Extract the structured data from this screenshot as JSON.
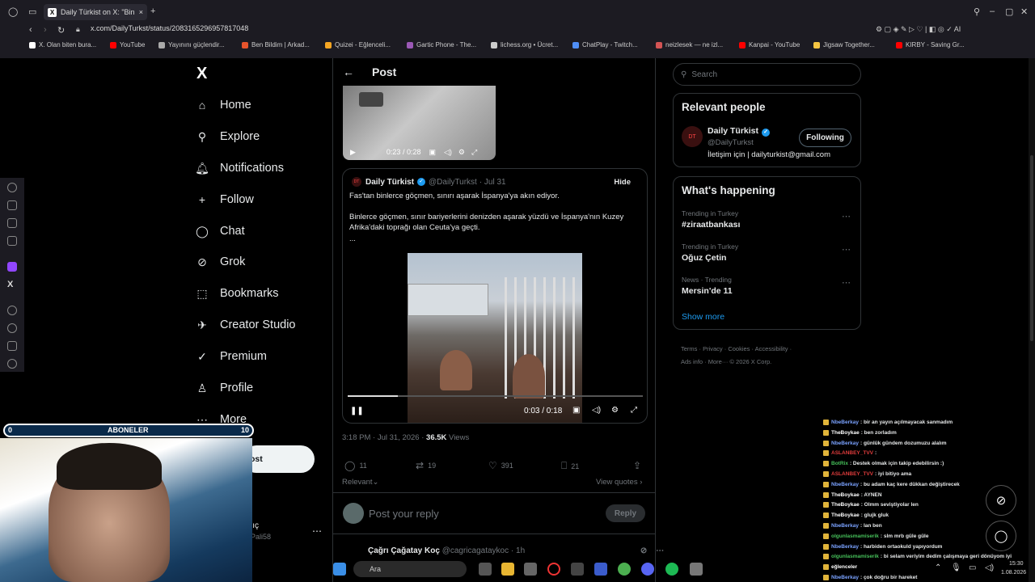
{
  "browser": {
    "tab_title": "Daily Türkist on X: \"Bin",
    "tab_icon": "X",
    "url": "x.com/DailyTurkst/status/2083165296957817048",
    "bookmarks": [
      {
        "label": "X. Olan biten bura...",
        "color": "#ffffff"
      },
      {
        "label": "YouTube",
        "color": "#ff0000"
      },
      {
        "label": "Yayınını güçlendir...",
        "color": "#aaaaaa"
      },
      {
        "label": "Ben Bildim | Arkad...",
        "color": "#e6542c"
      },
      {
        "label": "Quizei - Eğlenceli...",
        "color": "#f5a623"
      },
      {
        "label": "Gartic Phone - The...",
        "color": "#9b59b6"
      },
      {
        "label": "lichess.org • Ücret...",
        "color": "#cccccc"
      },
      {
        "label": "ChatPlay - Twitch...",
        "color": "#4f8ef7"
      },
      {
        "label": "neizlesek — ne izl...",
        "color": "#d35454"
      },
      {
        "label": "Kanpai - YouTube",
        "color": "#ff0000"
      },
      {
        "label": "Jigsaw Together...",
        "color": "#f5c542"
      },
      {
        "label": "KIRBY - Saving Gr...",
        "color": "#ff0000"
      }
    ]
  },
  "sidebar": {
    "logo": "X",
    "items": [
      {
        "label": "Home",
        "icon": "⌂"
      },
      {
        "label": "Explore",
        "icon": "⚲"
      },
      {
        "label": "Notifications",
        "icon": "🔔︎"
      },
      {
        "label": "Follow",
        "icon": "+"
      },
      {
        "label": "Chat",
        "icon": "◯"
      },
      {
        "label": "Grok",
        "icon": "⊘"
      },
      {
        "label": "Bookmarks",
        "icon": "⬚"
      },
      {
        "label": "Creator Studio",
        "icon": "✈"
      },
      {
        "label": "Premium",
        "icon": "✓"
      },
      {
        "label": "Profile",
        "icon": "♙"
      },
      {
        "label": "More",
        "icon": "⋯"
      }
    ],
    "post_button_fragment": "ost",
    "profile_name_fragment": "lıç",
    "profile_handle_fragment": "Pali58"
  },
  "post": {
    "header_title": "Post",
    "top_video_time": "0:23 / 0:28",
    "quote": {
      "author": "Daily Türkist",
      "handle": "@DailyTurkst",
      "date": "· Jul 31",
      "hide_label": "Hide",
      "line1": "Fas'tan binlerce göçmen, sınırı aşarak İspanya'ya akın ediyor.",
      "line2": "Binlerce göçmen, sınır bariyerlerini denizden aşarak yüzdü ve İspanya'nın Kuzey Afrika'daki toprağı olan Ceuta'ya geçti.",
      "ellipsis": "...",
      "video_time": "0:03 / 0:18",
      "progress": 0.17
    },
    "timestamp": "3:18 PM · Jul 31, 2026 ·",
    "views_count": "36.5K",
    "views_label": "Views",
    "actions": {
      "replies": "11",
      "reposts": "19",
      "likes": "391",
      "bookmarks": "21"
    },
    "relevant_label": "Relevant",
    "view_quotes_label": "View quotes",
    "reply_placeholder": "Post your reply",
    "reply_button": "Reply",
    "next_author": "Çağrı Çağatay Koç",
    "next_handle": "@cagricagataykoc · 1h"
  },
  "right": {
    "search_placeholder": "Search",
    "relevant_people_title": "Relevant people",
    "person_name": "Daily Türkist",
    "person_handle": "@DailyTurkst",
    "person_bio": "İletişim için | dailyturkist@gmail.com",
    "following_button": "Following",
    "happening_title": "What's happening",
    "trends": [
      {
        "category": "Trending in Turkey",
        "name": "#ziraatbankası"
      },
      {
        "category": "Trending in Turkey",
        "name": "Oğuz Çetin"
      },
      {
        "category": "News · Trending",
        "name": "Mersin'de 11"
      }
    ],
    "show_more": "Show more",
    "footer_line1": "Terms · Privacy · Cookies · Accessibility ·",
    "footer_line2": "Ads info · More··· © 2026 X Corp."
  },
  "overlay": {
    "subs_left": "0",
    "subs_label": "ABONELER",
    "subs_right": "10",
    "subs_progress": 0.0
  },
  "chat": [
    {
      "user": "NbeBerkay",
      "color": "#7aa2ff",
      "text": ": bir an yayın açılmayacak sanmadım"
    },
    {
      "user": "TheBoykae",
      "color": "#ffffff",
      "text": ": ben zorladım"
    },
    {
      "user": "NbeBerkay",
      "color": "#7aa2ff",
      "text": ": günlük gündem dozumuzu alalım"
    },
    {
      "user": "ASLANBEY_TVV",
      "color": "#e03c3c",
      "text": ":"
    },
    {
      "user": "BotRix",
      "color": "#46c05a",
      "text": ": Destek olmak için takip edebilirsin :)"
    },
    {
      "user": "ASLANBEY_TVV",
      "color": "#e03c3c",
      "text": ": iyi bitiyo ama"
    },
    {
      "user": "NbeBerkay",
      "color": "#7aa2ff",
      "text": ": bu adam kaç kere dükkan değiştirecek"
    },
    {
      "user": "TheBoykae",
      "color": "#ffffff",
      "text": ": AYNEN"
    },
    {
      "user": "TheBoykae",
      "color": "#ffffff",
      "text": ": Olmm seviştiyolar len"
    },
    {
      "user": "TheBoykae",
      "color": "#ffffff",
      "text": ": glujk gluk"
    },
    {
      "user": "NbeBerkay",
      "color": "#7aa2ff",
      "text": ": lan ben"
    },
    {
      "user": "olgunlasmamiserik",
      "color": "#46c05a",
      "text": ": slm mrb güle güle"
    },
    {
      "user": "NbeBerkay",
      "color": "#7aa2ff",
      "text": ": harbiden ortaokuld yapıyordum"
    },
    {
      "user": "olgunlasmamiserik",
      "color": "#46c05a",
      "text": ": bi selam veriyim dedim çalışmaya geri dönüyom iyi"
    },
    {
      "user": "eğlenceler",
      "color": "#ffffff",
      "text": ""
    },
    {
      "user": "NbeBerkay",
      "color": "#7aa2ff",
      "text": ": çok doğru bir hareket"
    }
  ],
  "taskbar": {
    "search_label": "Ara",
    "time": "15:30",
    "date": "1.08.2026"
  }
}
